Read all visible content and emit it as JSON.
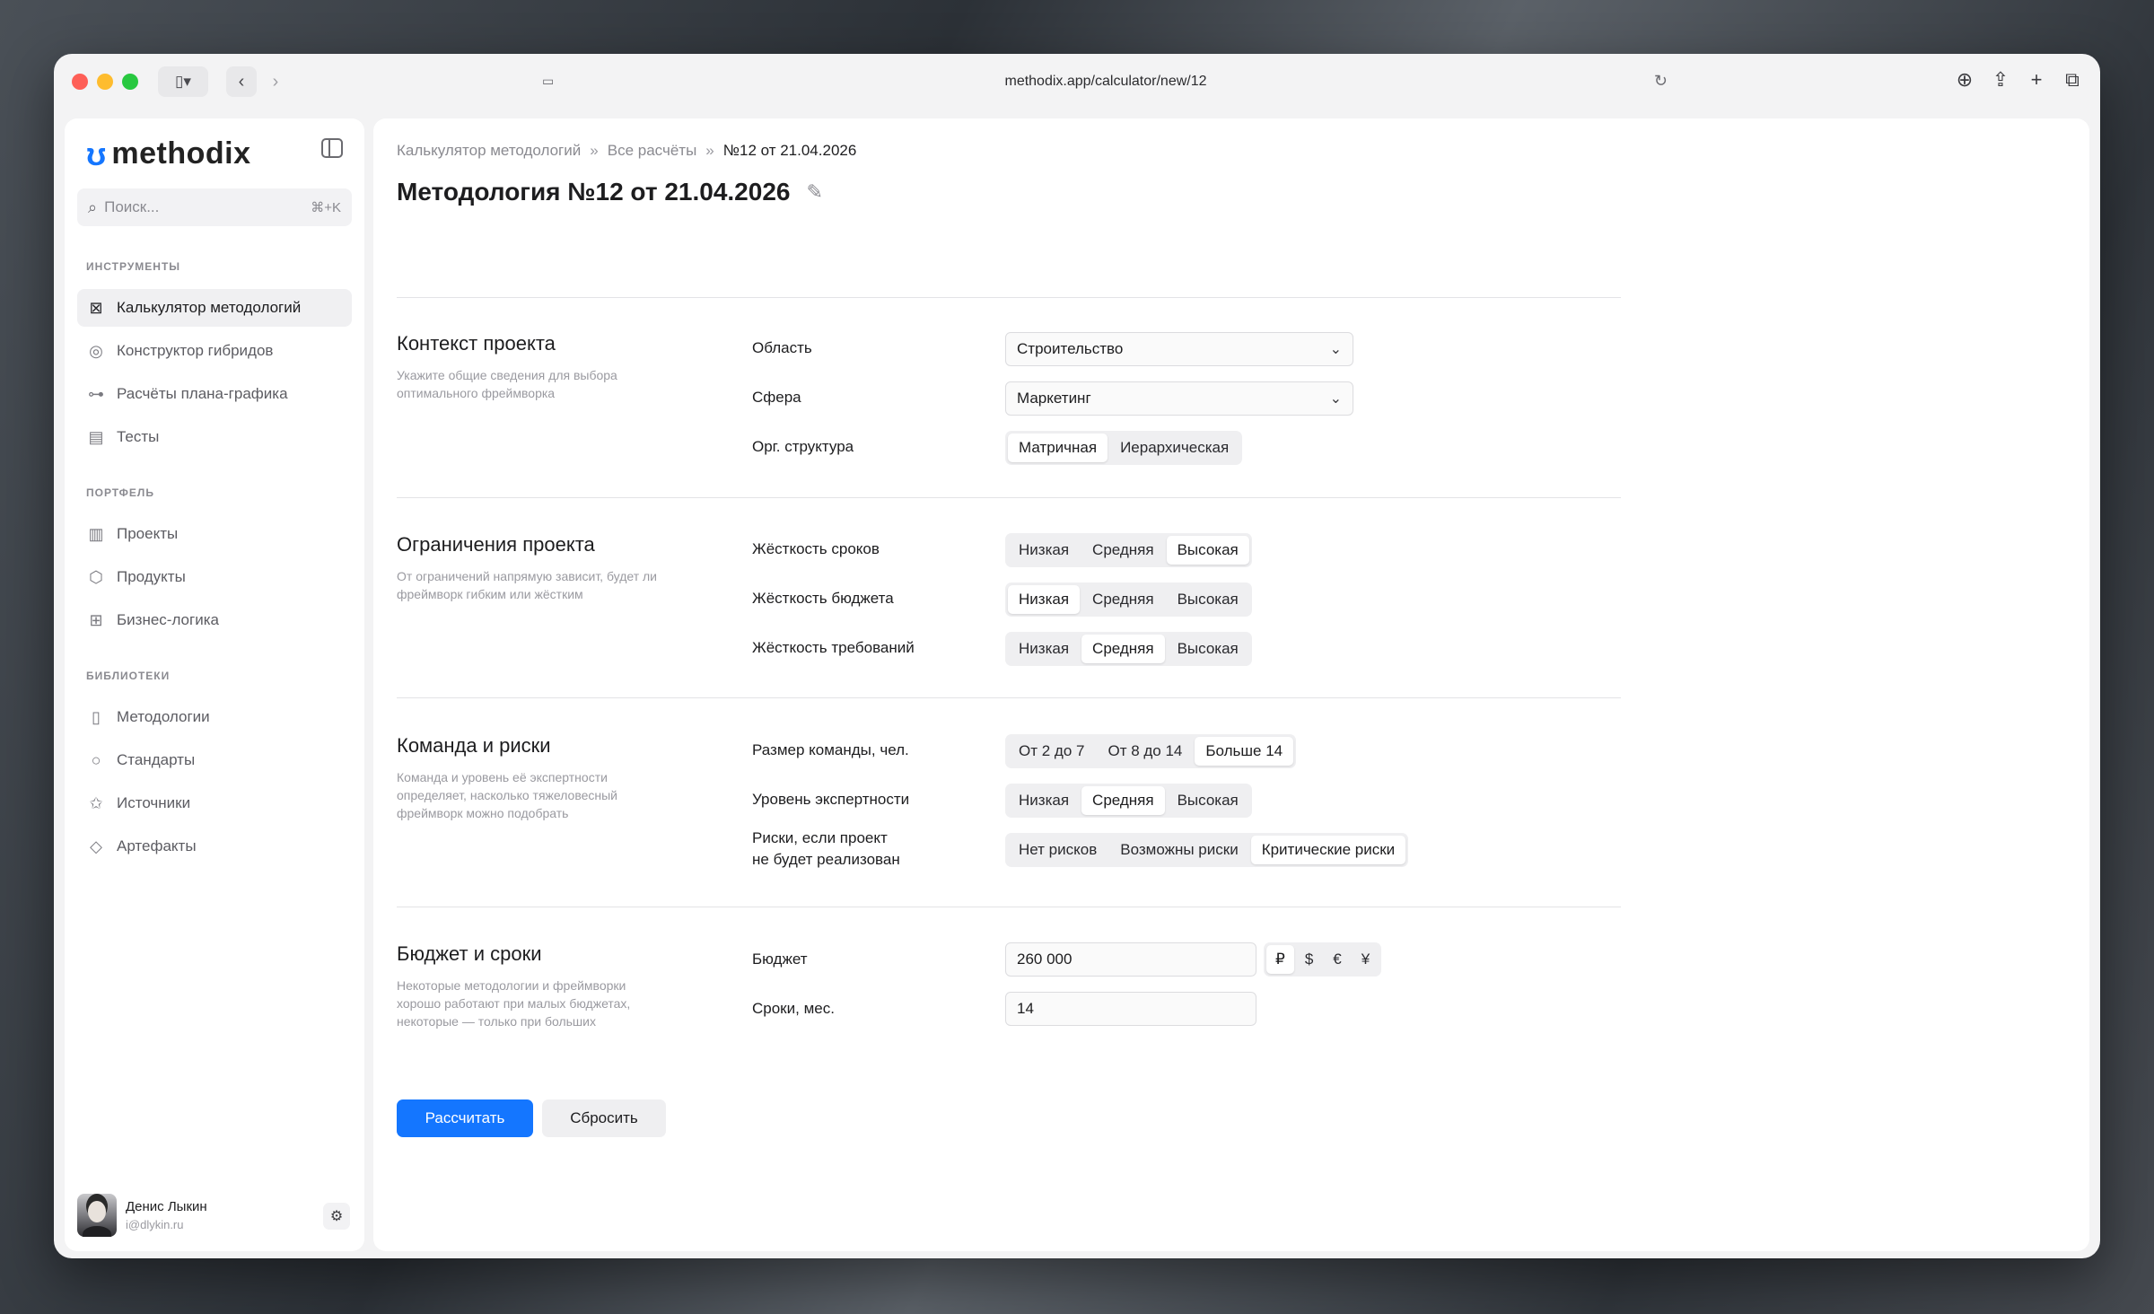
{
  "browser": {
    "url": "methodix.app/calculator/new/12"
  },
  "sidebar": {
    "logo_text": "methodix",
    "search": {
      "placeholder": "Поиск...",
      "shortcut": "⌘+K"
    },
    "sections": [
      {
        "label": "ИНСТРУМЕНТЫ",
        "items": [
          {
            "label": "Калькулятор методологий",
            "icon": "calculator-icon",
            "active": true
          },
          {
            "label": "Конструктор гибридов",
            "icon": "hybrid-icon"
          },
          {
            "label": "Расчёты плана-графика",
            "icon": "schedule-icon"
          },
          {
            "label": "Тесты",
            "icon": "tests-icon"
          }
        ]
      },
      {
        "label": "ПОРТФЕЛЬ",
        "items": [
          {
            "label": "Проекты",
            "icon": "briefcase-icon"
          },
          {
            "label": "Продукты",
            "icon": "box-icon"
          },
          {
            "label": "Бизнес-логика",
            "icon": "logic-icon"
          }
        ]
      },
      {
        "label": "БИБЛИОТЕКИ",
        "items": [
          {
            "label": "Методологии",
            "icon": "book-icon"
          },
          {
            "label": "Стандарты",
            "icon": "award-icon"
          },
          {
            "label": "Источники",
            "icon": "star-icon"
          },
          {
            "label": "Артефакты",
            "icon": "gem-icon"
          }
        ]
      }
    ],
    "user": {
      "name": "Денис Лыкин",
      "email": "i@dlykin.ru"
    }
  },
  "main": {
    "breadcrumb": [
      "Калькулятор методологий",
      "Все расчёты",
      "№12 от 21.04.2026"
    ],
    "breadcrumb_sep": "»",
    "title": "Методология №12 от 21.04.2026",
    "sections": {
      "context": {
        "title": "Контекст проекта",
        "desc": "Укажите общие сведения для выбора оптимального фреймворка",
        "area_label": "Область",
        "area_value": "Строительство",
        "sphere_label": "Сфера",
        "sphere_value": "Маркетинг",
        "org_label": "Орг. структура",
        "org_options": [
          "Матричная",
          "Иерархическая"
        ],
        "org_selected": 0
      },
      "constraints": {
        "title": "Ограничения проекта",
        "desc": "От ограничений напрямую зависит, будет ли фреймворк гибким или жёстким",
        "fields": [
          {
            "label": "Жёсткость сроков",
            "options": [
              "Низкая",
              "Средняя",
              "Высокая"
            ],
            "selected": 2
          },
          {
            "label": "Жёсткость бюджета",
            "options": [
              "Низкая",
              "Средняя",
              "Высокая"
            ],
            "selected": 0
          },
          {
            "label": "Жёсткость требований",
            "options": [
              "Низкая",
              "Средняя",
              "Высокая"
            ],
            "selected": 1
          }
        ]
      },
      "team": {
        "title": "Команда и риски",
        "desc": "Команда и уровень её экспертности определяет, насколько тяжеловесный фреймворк можно подобрать",
        "fields": [
          {
            "label": "Размер команды, чел.",
            "options": [
              "От 2 до 7",
              "От 8 до 14",
              "Больше 14"
            ],
            "selected": 2
          },
          {
            "label": "Уровень экспертности",
            "options": [
              "Низкая",
              "Средняя",
              "Высокая"
            ],
            "selected": 1
          },
          {
            "label": "Риски, если проект\nне будет реализован",
            "options": [
              "Нет рисков",
              "Возможны риски",
              "Критические риски"
            ],
            "selected": 2
          }
        ]
      },
      "budget": {
        "title": "Бюджет и сроки",
        "desc": "Некоторые методологии и фреймворки хорошо работают при малых бюджетах, некоторые — только при больших",
        "budget_label": "Бюджет",
        "budget_value": "260 000",
        "currencies": [
          "₽",
          "$",
          "€",
          "¥"
        ],
        "currency_selected": 0,
        "term_label": "Сроки, мес.",
        "term_value": "14"
      }
    },
    "actions": {
      "calculate": "Рассчитать",
      "reset": "Сбросить"
    }
  },
  "colors": {
    "accent": "#1476ff"
  }
}
